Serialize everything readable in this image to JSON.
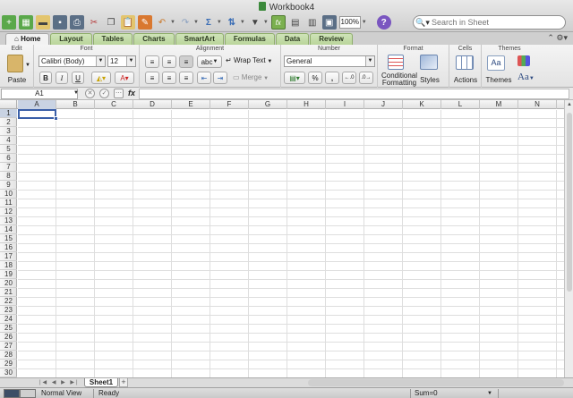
{
  "window": {
    "title": "Workbook4"
  },
  "toolbar": {
    "zoom": "100%",
    "search_placeholder": "Search in Sheet"
  },
  "ribbon": {
    "tabs": [
      "Home",
      "Layout",
      "Tables",
      "Charts",
      "SmartArt",
      "Formulas",
      "Data",
      "Review"
    ],
    "active_tab": "Home",
    "groups": {
      "edit": "Edit",
      "font": "Font",
      "alignment": "Alignment",
      "number": "Number",
      "format": "Format",
      "cells": "Cells",
      "themes": "Themes"
    },
    "paste_label": "Paste",
    "font_name": "Calibri (Body)",
    "font_size": "12",
    "bold": "B",
    "italic": "I",
    "underline": "U",
    "wrap_text": "Wrap Text",
    "abc": "abc",
    "merge": "Merge",
    "number_format": "General",
    "percent": "%",
    "comma": ",",
    "cond_format_line1": "Conditional",
    "cond_format_line2": "Formatting",
    "styles": "Styles",
    "actions": "Actions",
    "themes": "Themes",
    "aa": "Aa"
  },
  "formula_bar": {
    "name_box": "A1",
    "fx": "fx",
    "value": ""
  },
  "grid": {
    "columns": [
      "A",
      "B",
      "C",
      "D",
      "E",
      "F",
      "G",
      "H",
      "I",
      "J",
      "K",
      "L",
      "M",
      "N"
    ],
    "rows": [
      "1",
      "2",
      "3",
      "4",
      "5",
      "6",
      "7",
      "8",
      "9",
      "10",
      "11",
      "12",
      "13",
      "14",
      "15",
      "16",
      "17",
      "18",
      "19",
      "20",
      "21",
      "22",
      "23",
      "24",
      "25",
      "26",
      "27",
      "28",
      "29",
      "30"
    ],
    "selected_cell": "A1"
  },
  "sheets": {
    "tabs": [
      "Sheet1"
    ],
    "add": "+"
  },
  "status": {
    "view": "Normal View",
    "state": "Ready",
    "sum": "Sum=0"
  },
  "colors": {
    "ribbon_tab": "#b9d59a",
    "selection": "#3a5fa8",
    "header_active": "#c9d3e3"
  }
}
